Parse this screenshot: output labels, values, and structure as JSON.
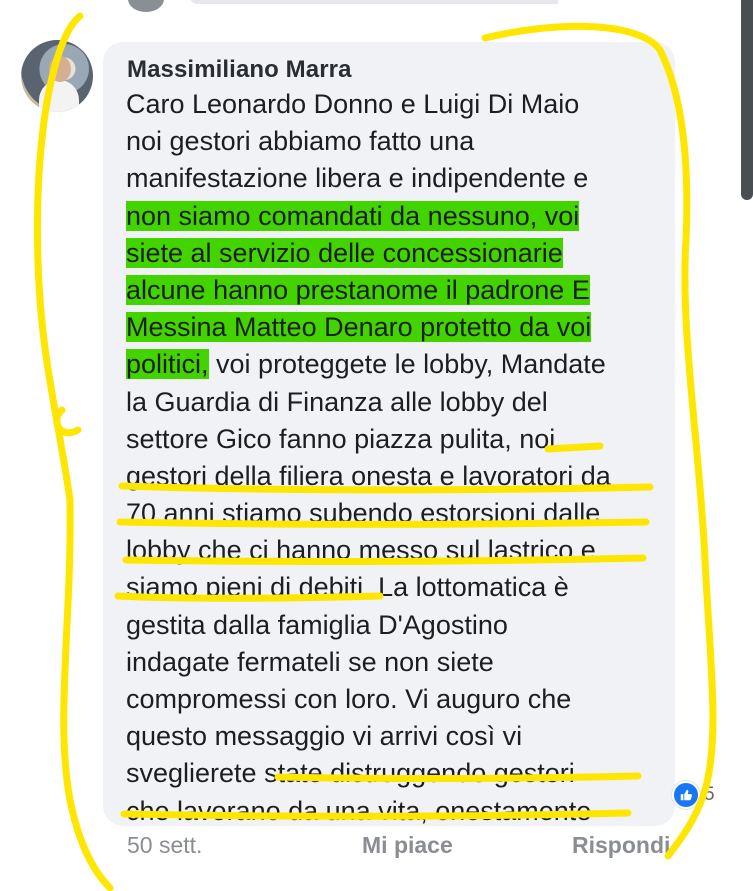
{
  "comment": {
    "author": "Massimiliano Marra",
    "lines": [
      {
        "pre": "Caro Leonardo Donno e Luigi Di Maio",
        "hl": "",
        "post": ""
      },
      {
        "pre": "noi gestori abbiamo fatto una",
        "hl": "",
        "post": ""
      },
      {
        "pre": "manifestazione libera e indipendente e",
        "hl": "",
        "post": ""
      },
      {
        "pre": "",
        "hl": "non siamo comandati da nessuno, voi",
        "post": ""
      },
      {
        "pre": "",
        "hl": "siete al servizio delle concessionarie",
        "post": ""
      },
      {
        "pre": "",
        "hl": "alcune hanno prestanome il padrone E",
        "post": ""
      },
      {
        "pre": "",
        "hl": "Messina Matteo Denaro protetto da voi",
        "post": ""
      },
      {
        "pre": "",
        "hl": "politici,",
        "post": " voi proteggete le lobby, Mandate"
      },
      {
        "pre": "la Guardia di Finanza alle lobby del",
        "hl": "",
        "post": ""
      },
      {
        "pre": "settore Gico fanno piazza pulita, noi",
        "hl": "",
        "post": ""
      },
      {
        "pre": "gestori della filiera onesta e lavoratori da",
        "hl": "",
        "post": ""
      },
      {
        "pre": "70 anni stiamo subendo estorsioni dalle",
        "hl": "",
        "post": ""
      },
      {
        "pre": "lobby che ci hanno messo sul lastrico e",
        "hl": "",
        "post": ""
      },
      {
        "pre": "siamo pieni di debiti. La lottomatica è",
        "hl": "",
        "post": ""
      },
      {
        "pre": "gestita dalla famiglia D'Agostino",
        "hl": "",
        "post": ""
      },
      {
        "pre": "indagate fermateli se non siete",
        "hl": "",
        "post": ""
      },
      {
        "pre": "compromessi con loro.  Vi auguro che",
        "hl": "",
        "post": ""
      },
      {
        "pre": "questo messaggio vi arrivi così vi",
        "hl": "",
        "post": ""
      },
      {
        "pre": "sveglierete  state distruggendo gestori",
        "hl": "",
        "post": ""
      },
      {
        "pre": "che lavorano da una vita, onestamente",
        "hl": "",
        "post": ""
      }
    ],
    "reaction_count": "5",
    "reaction_icon": "like-icon",
    "time": "50 sett.",
    "like_label": "Mi piace",
    "reply_label": "Rispondi"
  },
  "colors": {
    "highlight": "#43d400",
    "bubble": "#f0f2f5",
    "pen": "#ffe600",
    "reaction": "#1877f2"
  }
}
